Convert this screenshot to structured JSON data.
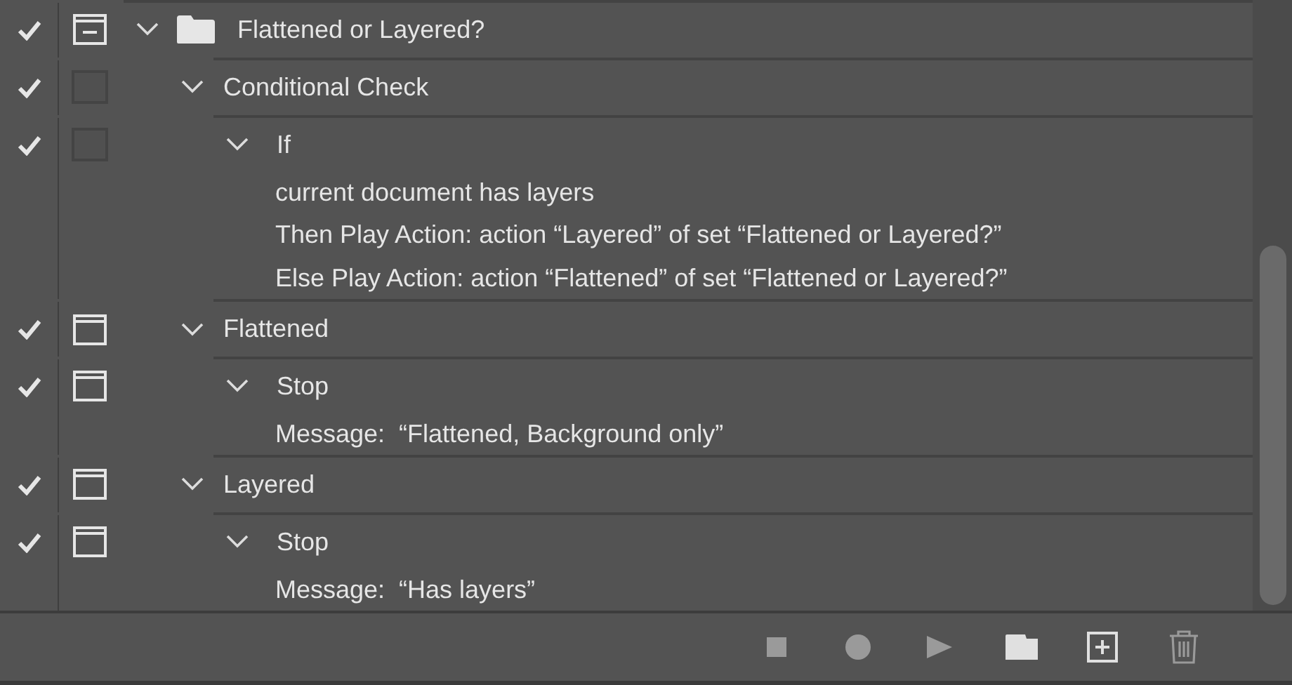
{
  "set": {
    "name": "Flattened or Layered?",
    "enabled": true,
    "dialog_available": true,
    "dialog_on": true,
    "dialog_mixed": true,
    "expanded": true,
    "children": [
      {
        "name": "Conditional Check",
        "enabled": true,
        "dialog_available": false,
        "expanded": true,
        "children": [
          {
            "name": "If",
            "enabled": true,
            "dialog_available": false,
            "expanded": true,
            "details": [
              "current document has layers",
              "Then Play Action: action “Layered” of set “Flattened or Layered?”",
              "Else Play Action: action “Flattened” of set “Flattened or Layered?”"
            ]
          }
        ]
      },
      {
        "name": "Flattened",
        "enabled": true,
        "dialog_available": true,
        "dialog_on": true,
        "dialog_mixed": false,
        "expanded": true,
        "children": [
          {
            "name": "Stop",
            "enabled": true,
            "dialog_available": true,
            "dialog_on": true,
            "dialog_mixed": false,
            "expanded": true,
            "details": [
              "Message:  “Flattened, Background only”"
            ]
          }
        ]
      },
      {
        "name": "Layered",
        "enabled": true,
        "dialog_available": true,
        "dialog_on": true,
        "dialog_mixed": false,
        "expanded": true,
        "children": [
          {
            "name": "Stop",
            "enabled": true,
            "dialog_available": true,
            "dialog_on": true,
            "dialog_mixed": false,
            "expanded": true,
            "details": [
              "Message:  “Has layers”"
            ]
          }
        ]
      }
    ]
  },
  "toolbar": [
    {
      "kind": "stop",
      "disabled": true
    },
    {
      "kind": "record",
      "disabled": true
    },
    {
      "kind": "play",
      "disabled": true
    },
    {
      "kind": "new-set",
      "disabled": false
    },
    {
      "kind": "new-action",
      "disabled": false
    },
    {
      "kind": "delete",
      "disabled": true
    }
  ]
}
